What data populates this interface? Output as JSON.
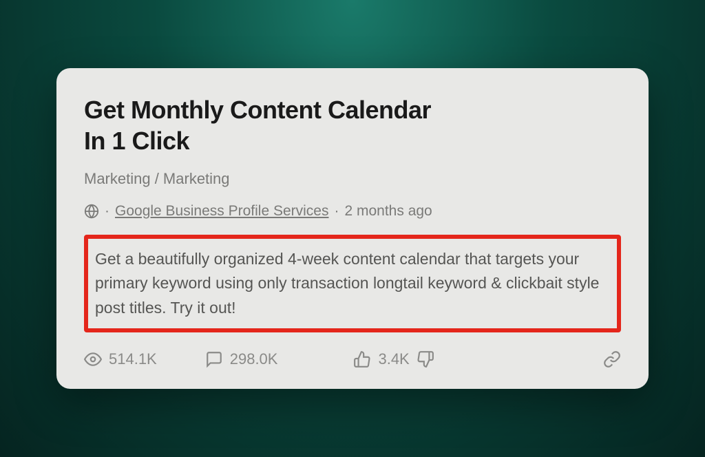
{
  "card": {
    "title_line1": "Get Monthly Content Calendar",
    "title_line2": "In 1 Click",
    "category": "Marketing / Marketing",
    "author": "Google Business Profile Services",
    "timestamp": "2 months ago",
    "description": "Get a beautifully organized 4-week content calendar that targets your primary keyword using only transaction longtail keyword & clickbait style post titles. Try it out!",
    "stats": {
      "views": "514.1K",
      "comments": "298.0K",
      "likes": "3.4K"
    }
  }
}
